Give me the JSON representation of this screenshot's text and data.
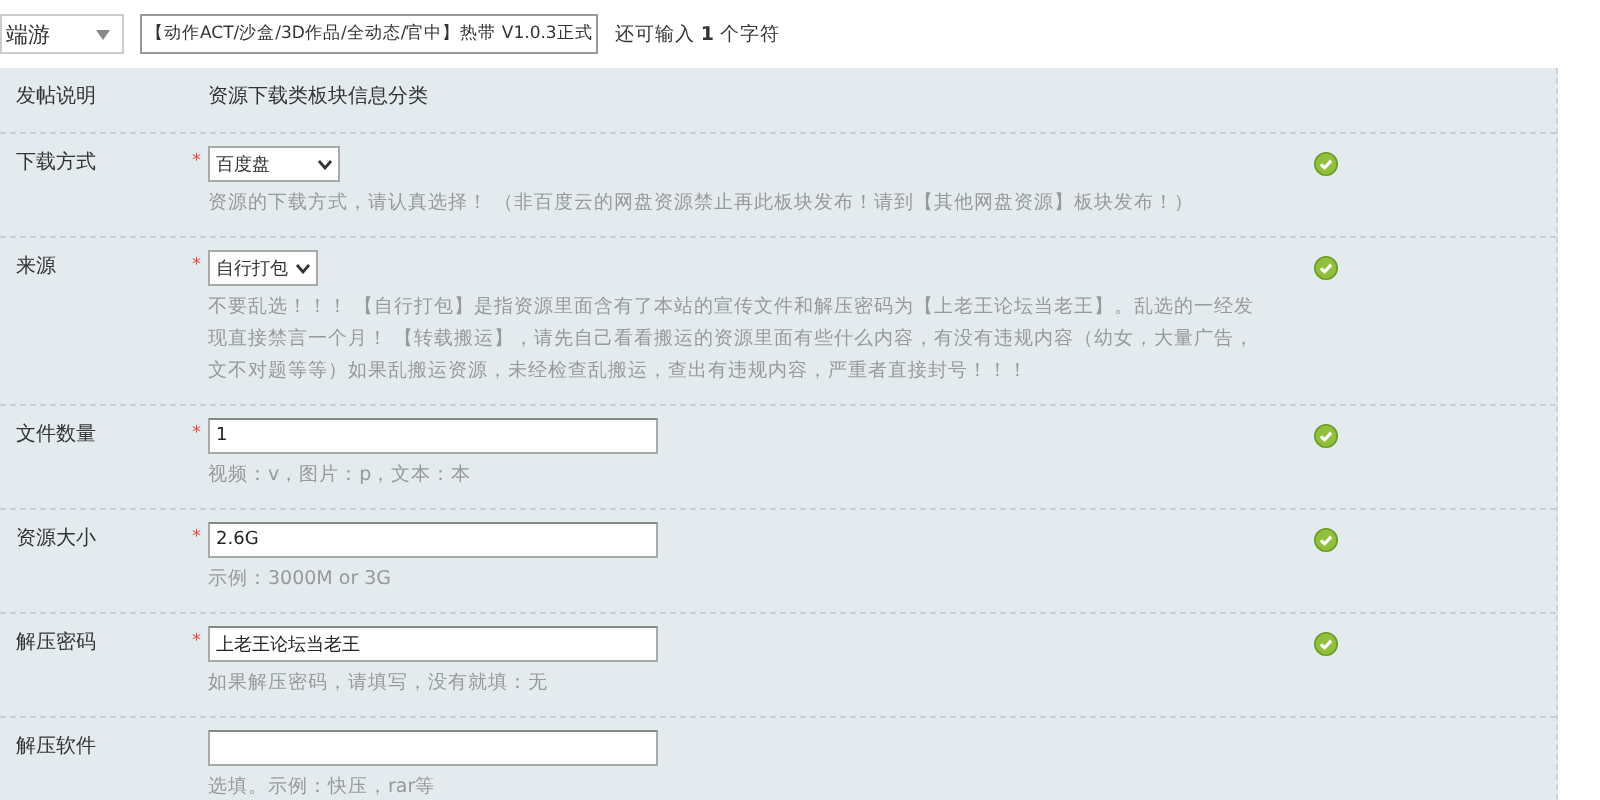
{
  "topbar": {
    "category": "端游",
    "title_value": "【动作ACT/沙盒/3D作品/全动态/官中】热带 V1.0.3正式",
    "counter": "还可输入 **1** 个字符"
  },
  "intro": {
    "label": "发帖说明",
    "text": "资源下载类板块信息分类"
  },
  "fields": [
    {
      "label": "下载方式",
      "kind": "select",
      "required_mark": "*",
      "value": "百度盘",
      "hint": "资源的下载方式，请认真选择！ （非百度云的网盘资源禁止再此板块发布！请到【其他网盘资源】板块发布！）",
      "valid": true
    },
    {
      "label": "来源",
      "kind": "select",
      "required_mark": "*",
      "value": "自行打包",
      "hint": "不要乱选！！！ 【自行打包】是指资源里面含有了本站的宣传文件和解压密码为【上老王论坛当老王】。乱选的一经发现直接禁言一个月！ 【转载搬运】，请先自己看看搬运的资源里面有些什么内容，有没有违规内容（幼女，大量广告，文不对题等等）如果乱搬运资源，未经检查乱搬运，查出有违规内容，严重者直接封号！！！",
      "valid": true
    },
    {
      "label": "文件数量",
      "kind": "text",
      "required_mark": "*",
      "value": "1",
      "hint": "视频：v，图片：p，文本：本",
      "valid": true
    },
    {
      "label": "资源大小",
      "kind": "text",
      "required_mark": "*",
      "value": "2.6G",
      "hint": "示例：3000M or 3G",
      "valid": true
    },
    {
      "label": "解压密码",
      "kind": "text",
      "required_mark": "*",
      "value": "上老王论坛当老王",
      "hint": "如果解压密码，请填写，没有就填：无",
      "valid": true
    },
    {
      "label": "解压软件",
      "kind": "text",
      "hint": "选填。示例：快压，rar等",
      "valid": false
    }
  ]
}
